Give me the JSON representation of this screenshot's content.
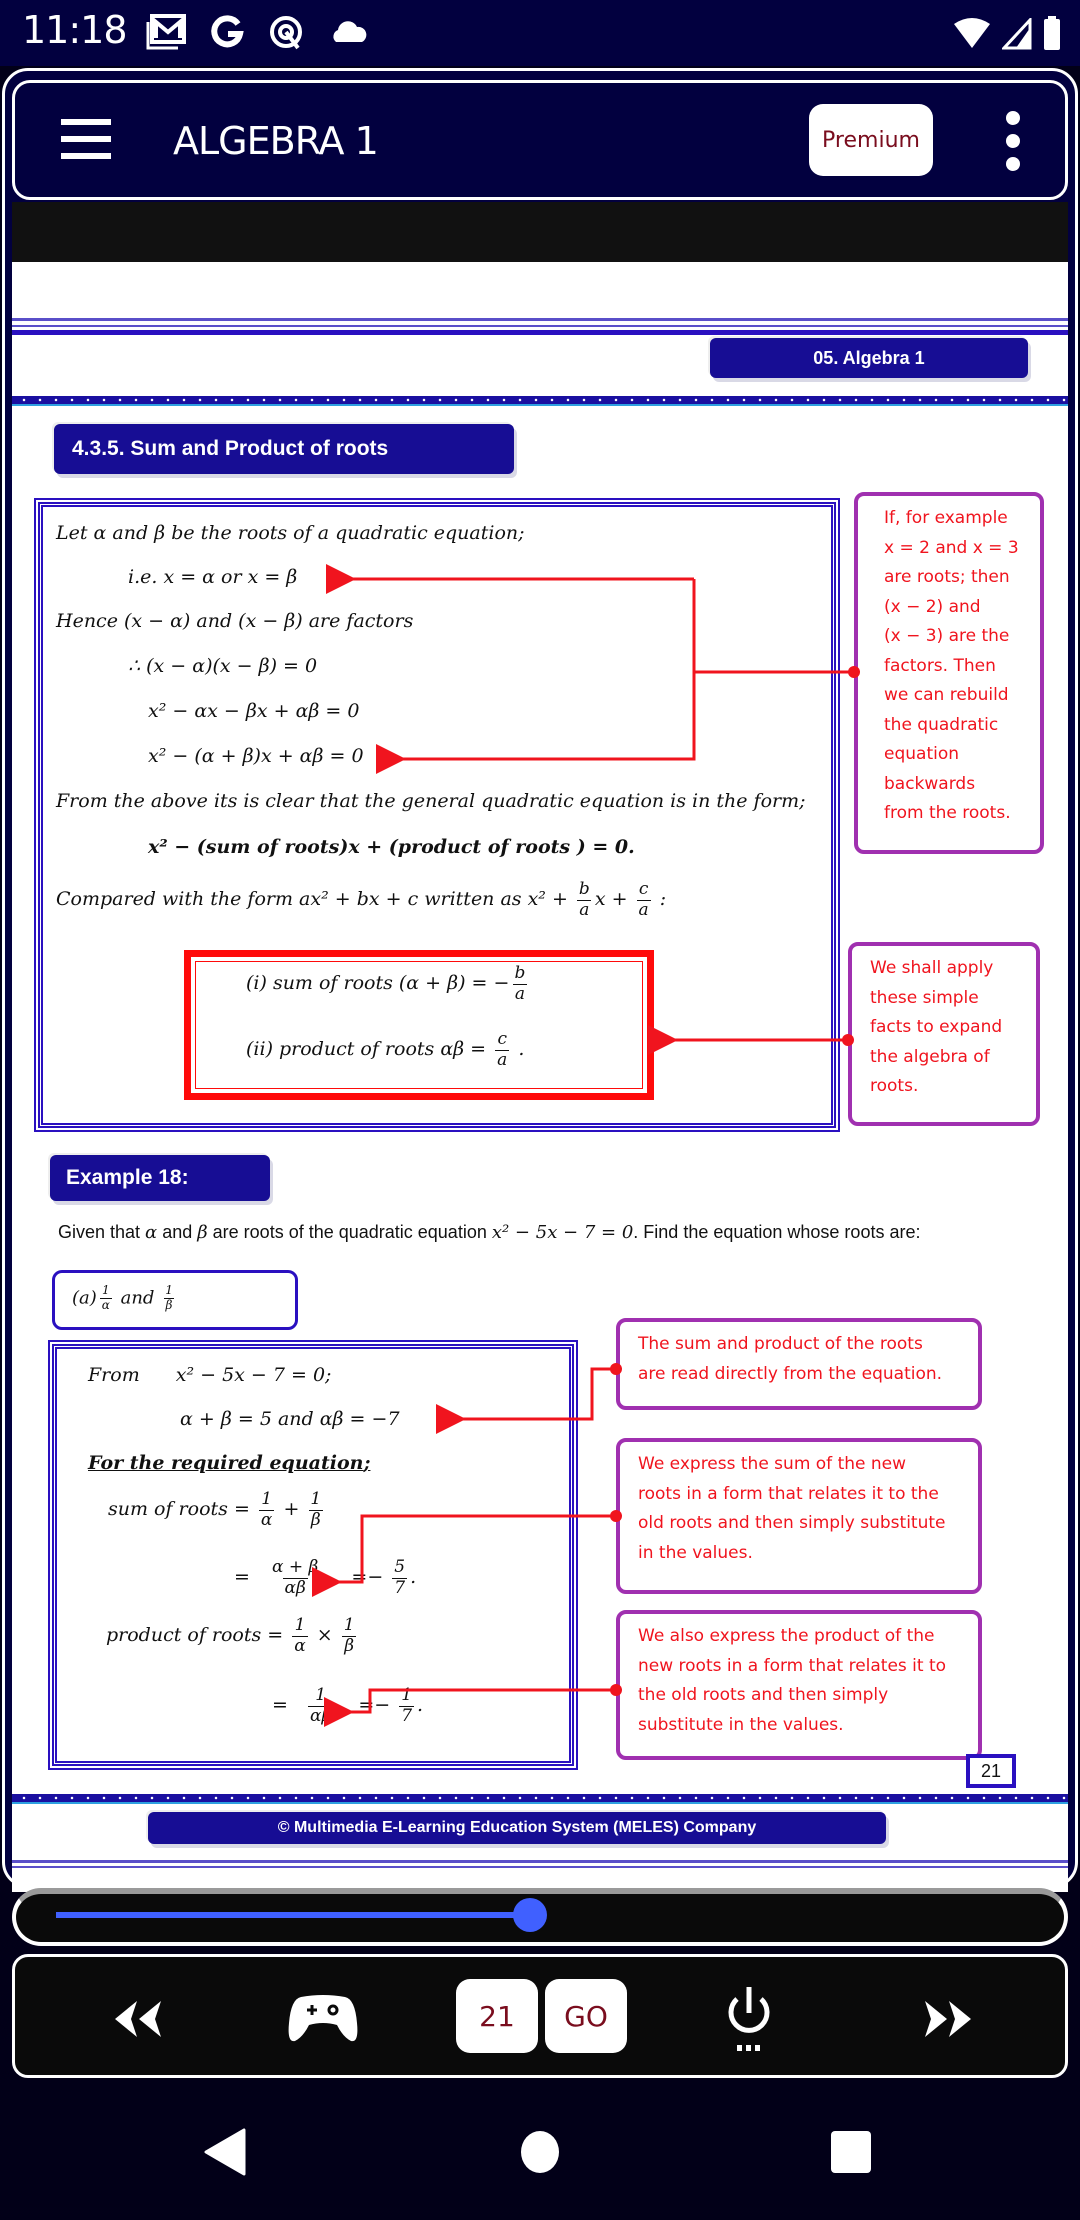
{
  "status_bar": {
    "time": "11:18",
    "left_icons": [
      "gmail-icon",
      "google-icon",
      "vpn-icon",
      "cloud-icon"
    ],
    "right_icons": [
      "wifi-icon",
      "cell-signal-icon",
      "battery-icon"
    ]
  },
  "app_bar": {
    "title": "ALGEBRA 1",
    "premium_label": "Premium",
    "menu_icon": "hamburger-icon",
    "overflow_icon": "kebab-icon"
  },
  "page": {
    "chapter_label": "05. Algebra 1",
    "section_title": "4.3.5. Sum and Product of roots",
    "theory": {
      "line1": "Let  α  and β be the roots of a quadratic equation;",
      "line2": "i.e. x = α   or    x = β",
      "line3": "Hence  (x − α)  and  (x − β) are factors",
      "line4": "∴ (x − α)(x − β)  = 0",
      "line5": "x² − αx − βx +  αβ  = 0",
      "line6": "x² − (α + β)x +  αβ = 0",
      "line7": "From the above its  is clear that  the general quadratic equation is in the form;",
      "general_form_prefix": "x²  − (",
      "general_form_sum": "sum of roots",
      "general_form_mid": ")x + (",
      "general_form_product": "product of roots",
      "general_form_suffix": " ) = 0.",
      "compare_text": "Compared with the form  ax² + bx + c  written as  x² + ",
      "compare_x": "x  + ",
      "compare_colon": " :",
      "frac_b": "b",
      "frac_a": "a",
      "frac_c": "c"
    },
    "facts": {
      "sum_label": "(i)  sum of roots  (α + β)  =  −",
      "product_label": "(ii)  product of roots  αβ   =  ",
      "b": "b",
      "a": "a",
      "c": "c",
      "period": " ."
    },
    "notes": {
      "note1": [
        "If, for example",
        "x = 2 and x = 3",
        "are roots; then",
        "(x − 2)  and",
        "(x − 3)  are the",
        "factors. Then",
        "we can rebuild",
        "the quadratic",
        "equation",
        "backwards",
        "from the roots."
      ],
      "note2": [
        "We shall apply",
        "these simple",
        "facts to expand",
        "the algebra of",
        "roots."
      ],
      "note3": [
        "The sum and product of the roots",
        "are read directly from the equation."
      ],
      "note4": [
        "We express the sum of the new",
        "roots in a form that relates it to the",
        "old roots and then simply substitute",
        "in the values."
      ],
      "note5": [
        "We also express the product of the",
        "new roots in a form that relates it to",
        "the old roots and then simply",
        "substitute in the values."
      ]
    },
    "example": {
      "title": "Example 18:",
      "given_prefix": "Given that ",
      "alpha": "α",
      "and": " and ",
      "beta": "β",
      "given_mid": " are roots of the quadratic equation ",
      "equation": "x² − 5x − 7 = 0",
      "given_suffix": ". Find the equation whose roots are:",
      "option_a_label": "(a)",
      "option_a_and": " and ",
      "one": "1",
      "solution": {
        "from_label": "From",
        "from_eq": "x² − 5x − 7 = 0;",
        "sum_prod": "α + β  =  5    and    αβ  =  −7",
        "required": "For the required equation",
        "required_suffix": ";",
        "sum_label": "sum of roots  =",
        "plus": "+",
        "eq": "=",
        "alpha_plus_beta": "α + β",
        "alpha_beta": "αβ",
        "alpha": "α",
        "beta": "β",
        "neg": "−",
        "five": "5",
        "seven": "7",
        "one": "1",
        "product_label": "product of roots  =",
        "times": "×",
        "period": "."
      }
    },
    "page_number": "21",
    "footer": "© Multimedia E-Learning Education System (MELES) Company"
  },
  "slider": {
    "progress": 0.49
  },
  "toolbar": {
    "rewind_icon": "rewind-icon",
    "game_icon": "gamepad-icon",
    "page_input_value": "21",
    "go_label": "GO",
    "power_icon": "power-icon",
    "forward_icon": "fast-forward-icon"
  },
  "nav_bar": {
    "back": "back-icon",
    "home": "home-icon",
    "recents": "recents-icon"
  },
  "colors": {
    "app_navy": "#02003f",
    "chip_blue": "#170d94",
    "border_blue": "#2a10c0",
    "note_purple": "#a030b0",
    "note_red": "#f0141e",
    "premium_text": "#7a0d1e",
    "slider_blue": "#4060ff"
  }
}
